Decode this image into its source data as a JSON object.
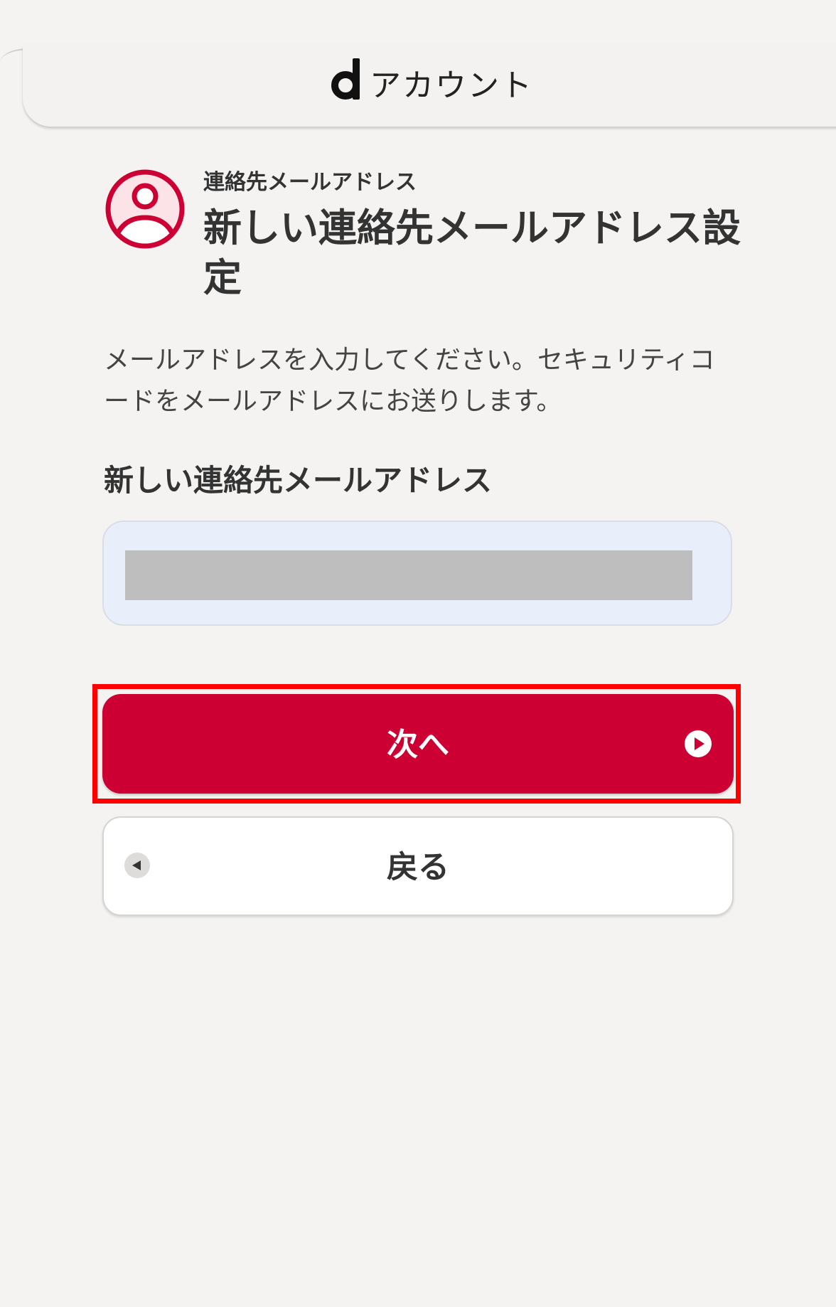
{
  "header": {
    "brand_letter": "d",
    "brand_text": "アカウント",
    "brand_icon": "d-logo-icon"
  },
  "section": {
    "icon": "person-circle-icon",
    "subtitle": "連絡先メールアドレス",
    "title": "新しい連絡先メールアドレス設定"
  },
  "description": "メールアドレスを入力してください。セキュリティコードをメールアドレスにお送りします。",
  "field": {
    "label": "新しい連絡先メールアドレス",
    "value": "",
    "redacted": true
  },
  "buttons": {
    "next_label": "次へ",
    "next_icon": "play-circle-icon",
    "back_label": "戻る",
    "back_icon": "back-arrow-icon"
  },
  "colors": {
    "accent": "#cc0033",
    "highlight": "#ff0000",
    "background": "#f4f3f1",
    "field_bg": "#e8eefa"
  }
}
